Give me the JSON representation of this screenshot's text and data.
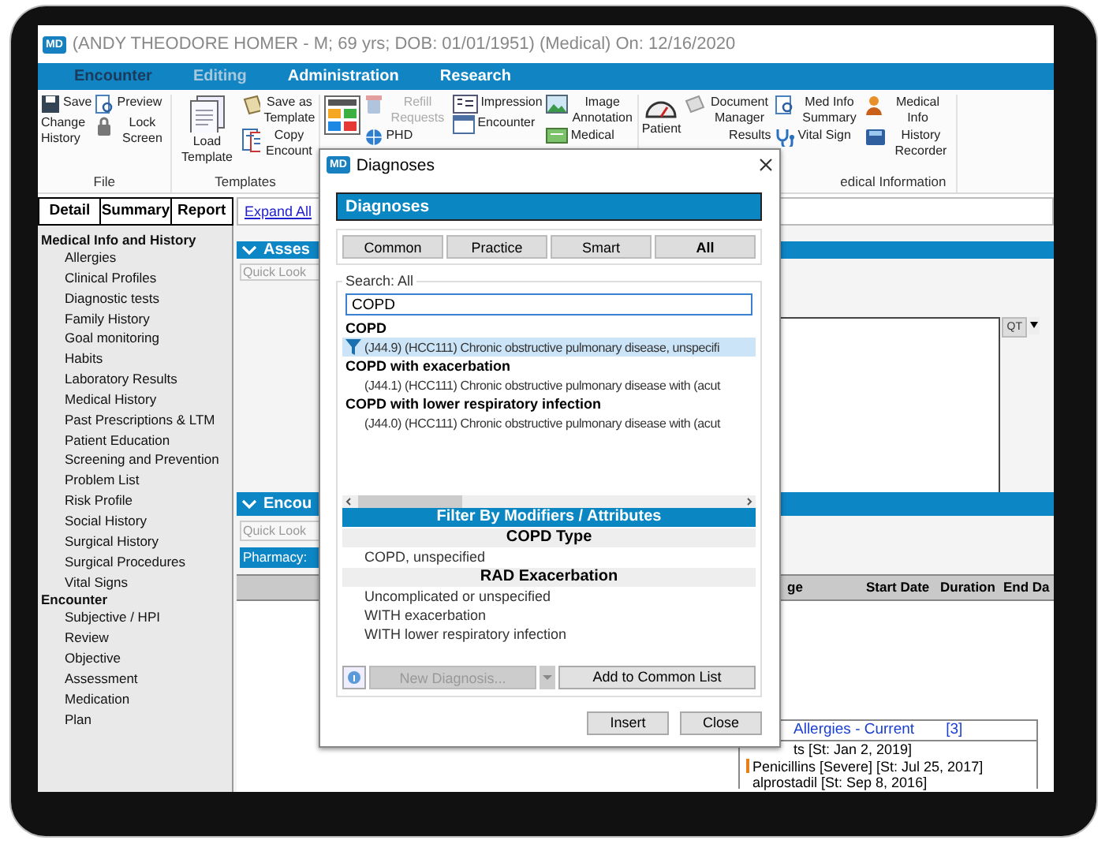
{
  "window": {
    "logo": "MD",
    "title": "(ANDY THEODORE HOMER - M; 69 yrs; DOB: 01/01/1951) (Medical) On: 12/16/2020"
  },
  "menu": [
    {
      "label": "Encounter",
      "selected": true,
      "disabled": false
    },
    {
      "label": "Editing",
      "selected": false,
      "disabled": true
    },
    {
      "label": "Administration",
      "selected": false,
      "disabled": false
    },
    {
      "label": "Research",
      "selected": false,
      "disabled": false
    }
  ],
  "ribbon": [
    {
      "label": "File",
      "columns": [
        [
          {
            "label": "Save",
            "kind": "small",
            "disabled": false
          },
          {
            "label": "Change History",
            "kind": "text",
            "disabled": false
          }
        ],
        [
          {
            "label": "Preview",
            "kind": "small",
            "disabled": false
          },
          {
            "label": "Lock Screen",
            "kind": "small",
            "disabled": false
          }
        ]
      ]
    },
    {
      "label": "Templates",
      "columns": [
        [
          {
            "label": "Load Template",
            "kind": "large",
            "disabled": false
          }
        ],
        [
          {
            "label": "Save as Template",
            "kind": "small",
            "disabled": false
          },
          {
            "label": "Copy Encount",
            "kind": "small",
            "disabled": false
          }
        ]
      ]
    },
    {
      "columns": [
        [
          {
            "kind": "icon",
            "disabled": false
          }
        ],
        [
          {
            "label": "Refill Requests",
            "kind": "small",
            "disabled": true
          },
          {
            "label": "PHD",
            "kind": "small",
            "disabled": false
          }
        ],
        [
          {
            "label": "Impression",
            "kind": "small",
            "disabled": false
          },
          {
            "label": "Encounter",
            "kind": "small",
            "disabled": false
          }
        ],
        [
          {
            "label": "Image Annotation",
            "kind": "small",
            "disabled": false
          },
          {
            "label": "Medical",
            "kind": "small",
            "disabled": false
          }
        ]
      ]
    },
    {
      "label": "edical Information",
      "columns": [
        [
          {
            "label": "Patient",
            "kind": "large",
            "disabled": false
          }
        ],
        [
          {
            "label": "Document Manager",
            "kind": "small",
            "disabled": false
          },
          {
            "label": "Results",
            "kind": "text",
            "disabled": false
          }
        ],
        [
          {
            "label": "Med Info Summary",
            "kind": "small",
            "disabled": false
          },
          {
            "label": "Vital Sign",
            "kind": "small",
            "disabled": false
          }
        ],
        [
          {
            "label": "Medical Info",
            "kind": "small",
            "disabled": false
          },
          {
            "label": "History Recorder",
            "kind": "small",
            "disabled": false
          }
        ]
      ]
    }
  ],
  "sidebar": {
    "tabs": [
      "Detail",
      "Summary",
      "Report"
    ],
    "tree": [
      {
        "label": "Medical Info and History",
        "children": [
          {
            "label": "Allergies"
          },
          {
            "label": "Clinical Profiles"
          },
          {
            "label": "Diagnostic tests"
          },
          {
            "label": "Family History"
          },
          {
            "label": "Goal monitoring"
          },
          {
            "label": "Habits"
          },
          {
            "label": "Laboratory Results"
          },
          {
            "label": "Medical History"
          },
          {
            "label": "Past Prescriptions & LTM"
          },
          {
            "label": "Patient Education"
          },
          {
            "label": "Screening and Prevention"
          },
          {
            "label": "Problem List"
          },
          {
            "label": "Risk Profile"
          },
          {
            "label": "Social History"
          },
          {
            "label": "Surgical History"
          },
          {
            "label": "Surgical Procedures"
          },
          {
            "label": "Vital Signs"
          }
        ]
      },
      {
        "label": "Encounter",
        "children": [
          {
            "label": "Subjective / HPI"
          },
          {
            "label": "Review"
          },
          {
            "label": "Objective"
          },
          {
            "label": "Assessment"
          },
          {
            "label": "Medication"
          },
          {
            "label": "Plan"
          }
        ]
      }
    ]
  },
  "main": {
    "expand_all": "Expand All",
    "assessment": {
      "title": "Asses",
      "lookup_placeholder": "Quick Look",
      "qt_button": "QT"
    },
    "encounter": {
      "title": "Encou",
      "lookup_placeholder": "Quick Look",
      "pharmacy_label": "Pharmacy:",
      "table": {
        "columns": [
          "ge",
          "Start Date",
          "Duration",
          "End Da"
        ]
      },
      "allergies": {
        "title": "Allergies - Current",
        "count": "[3]",
        "rows": [
          {
            "text": "ts [St: Jan 2, 2019]",
            "flagged": false
          },
          {
            "text": "Penicillins [Severe] [St: Jul 25, 2017]",
            "flagged": true
          },
          {
            "text": "alprostadil [St: Sep 8, 2016]",
            "flagged": false
          }
        ]
      }
    }
  },
  "dialog": {
    "logo": "MD",
    "title": "Diagnoses",
    "header": "Diagnoses",
    "tabs": [
      {
        "label": "Common",
        "selected": false
      },
      {
        "label": "Practice",
        "selected": false
      },
      {
        "label": "Smart",
        "selected": false
      },
      {
        "label": "All",
        "selected": true
      }
    ],
    "search": {
      "legend": "Search: All",
      "value": "COPD"
    },
    "results": [
      {
        "label": "COPD",
        "items": [
          {
            "text": "(J44.9) (HCC111) Chronic obstructive pulmonary disease, unspecifi",
            "selected": true
          }
        ]
      },
      {
        "label": "COPD with exacerbation",
        "items": [
          {
            "text": "(J44.1) (HCC111) Chronic obstructive pulmonary disease with (acut",
            "selected": false
          }
        ]
      },
      {
        "label": "COPD with lower respiratory infection",
        "items": [
          {
            "text": "(J44.0) (HCC111) Chronic obstructive pulmonary disease with (acut",
            "selected": false
          }
        ]
      }
    ],
    "filter": {
      "title": "Filter By Modifiers / Attributes",
      "sections": [
        {
          "title": "COPD Type",
          "options": [
            "COPD, unspecified"
          ]
        },
        {
          "title": "RAD Exacerbation",
          "options": [
            "Uncomplicated or unspecified",
            "WITH exacerbation",
            "WITH lower respiratory infection"
          ]
        }
      ]
    },
    "new_diagnosis": {
      "label": "New Diagnosis...",
      "disabled": true
    },
    "add_button": "Add to Common List",
    "buttons": [
      "Insert",
      "Close"
    ]
  }
}
